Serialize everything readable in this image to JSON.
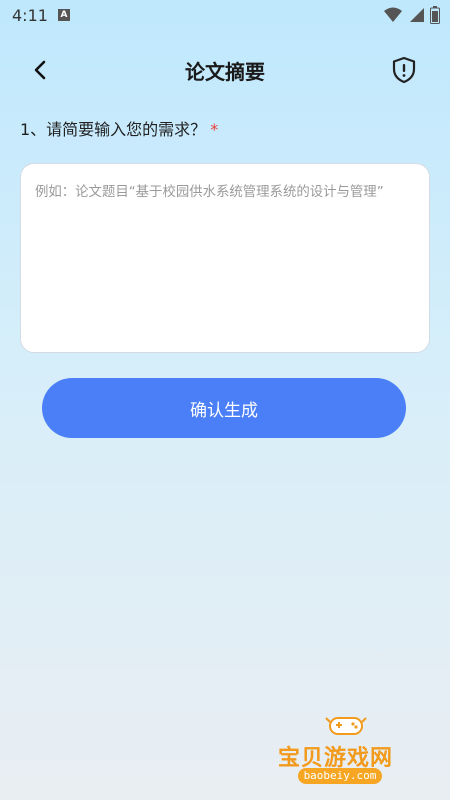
{
  "status_bar": {
    "time": "4:11",
    "notification_letter": "A"
  },
  "header": {
    "title": "论文摘要"
  },
  "form": {
    "question_label": "1、请简要输入您的需求？",
    "required_mark": "*",
    "textarea_value": "",
    "textarea_placeholder": "例如：论文题目“基于校园供水系统管理系统的设计与管理”"
  },
  "actions": {
    "submit_label": "确认生成"
  },
  "watermark": {
    "text": "宝贝游戏网",
    "url": "baobeiy.com"
  },
  "colors": {
    "primary": "#4a7ff7",
    "required": "#e8413b",
    "watermark": "#f29a1c"
  }
}
